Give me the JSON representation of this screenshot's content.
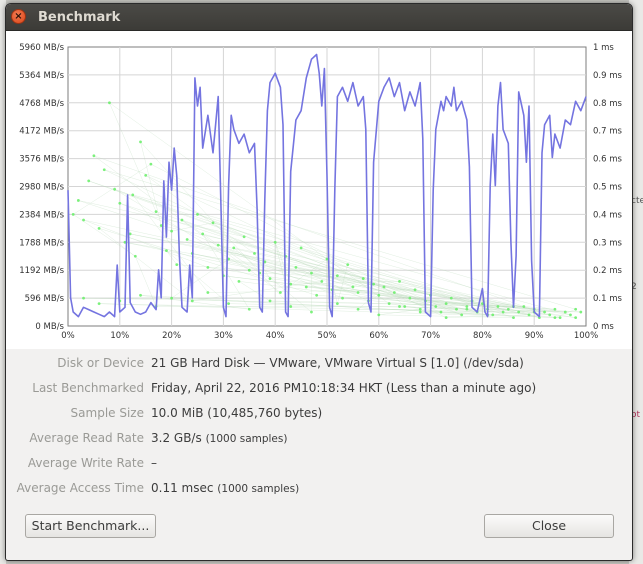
{
  "window": {
    "title": "Benchmark"
  },
  "background": {
    "frags": [
      "M",
      "M",
      "cte",
      "2",
      "ot"
    ]
  },
  "chart_data": [
    {
      "type": "line",
      "title": "",
      "xlabel": "",
      "ylabel": "",
      "x_ticks": [
        "0%",
        "10%",
        "20%",
        "30%",
        "40%",
        "50%",
        "60%",
        "70%",
        "80%",
        "90%",
        "100%"
      ],
      "y_left_ticks": [
        "0 MB/s",
        "596 MB/s",
        "1192 MB/s",
        "1788 MB/s",
        "2384 MB/s",
        "2980 MB/s",
        "3576 MB/s",
        "4172 MB/s",
        "4768 MB/s",
        "5364 MB/s",
        "5960 MB/s"
      ],
      "y_right_ticks": [
        "0 ms",
        "0.1 ms",
        "0.2 ms",
        "0.3 ms",
        "0.4 ms",
        "0.5 ms",
        "0.6 ms",
        "0.7 ms",
        "0.8 ms",
        "0.9 ms",
        "1 ms"
      ],
      "xlim": [
        0,
        100
      ],
      "ylim_left": [
        0,
        5960
      ],
      "ylim_right": [
        0,
        1
      ],
      "grid": true,
      "series_color": "#7474e0",
      "access_color": "#66ee66",
      "read_rate_points": [
        [
          0,
          2900
        ],
        [
          0.5,
          600
        ],
        [
          1,
          300
        ],
        [
          2,
          200
        ],
        [
          3,
          400
        ],
        [
          4,
          350
        ],
        [
          5,
          300
        ],
        [
          6,
          250
        ],
        [
          7,
          200
        ],
        [
          8,
          300
        ],
        [
          9,
          200
        ],
        [
          9.5,
          1300
        ],
        [
          10,
          300
        ],
        [
          11,
          400
        ],
        [
          11.5,
          2800
        ],
        [
          12,
          500
        ],
        [
          13,
          300
        ],
        [
          14,
          250
        ],
        [
          15,
          300
        ],
        [
          16,
          500
        ],
        [
          17,
          350
        ],
        [
          17.5,
          1200
        ],
        [
          18,
          600
        ],
        [
          18.5,
          3100
        ],
        [
          19,
          1900
        ],
        [
          19.5,
          3500
        ],
        [
          20,
          2900
        ],
        [
          20.5,
          3800
        ],
        [
          21,
          3200
        ],
        [
          21.5,
          1500
        ],
        [
          22,
          400
        ],
        [
          23,
          300
        ],
        [
          23.5,
          1300
        ],
        [
          24,
          600
        ],
        [
          24.5,
          5300
        ],
        [
          25,
          4700
        ],
        [
          25.5,
          5100
        ],
        [
          26,
          3800
        ],
        [
          27,
          4500
        ],
        [
          28,
          3700
        ],
        [
          29,
          4900
        ],
        [
          29.5,
          2700
        ],
        [
          30,
          400
        ],
        [
          30.5,
          200
        ],
        [
          31,
          3000
        ],
        [
          31.5,
          4500
        ],
        [
          32,
          4200
        ],
        [
          33,
          3900
        ],
        [
          34,
          4100
        ],
        [
          35,
          3700
        ],
        [
          36,
          3900
        ],
        [
          36.5,
          2500
        ],
        [
          37,
          400
        ],
        [
          37.5,
          300
        ],
        [
          38,
          2700
        ],
        [
          38.5,
          4600
        ],
        [
          39,
          5200
        ],
        [
          40,
          5400
        ],
        [
          41,
          5100
        ],
        [
          41.5,
          4300
        ],
        [
          42,
          300
        ],
        [
          42.5,
          200
        ],
        [
          43,
          3300
        ],
        [
          44,
          4400
        ],
        [
          45,
          4600
        ],
        [
          46,
          5300
        ],
        [
          47,
          5700
        ],
        [
          48,
          5800
        ],
        [
          48.5,
          5400
        ],
        [
          49,
          4700
        ],
        [
          49.5,
          5500
        ],
        [
          50,
          3200
        ],
        [
          50.5,
          400
        ],
        [
          51,
          200
        ],
        [
          51.5,
          2900
        ],
        [
          52,
          4900
        ],
        [
          53,
          5100
        ],
        [
          54,
          4800
        ],
        [
          55,
          5200
        ],
        [
          56,
          4700
        ],
        [
          57,
          4900
        ],
        [
          57.5,
          4200
        ],
        [
          58,
          500
        ],
        [
          58.5,
          300
        ],
        [
          59,
          3500
        ],
        [
          60,
          4800
        ],
        [
          61,
          5100
        ],
        [
          62,
          5300
        ],
        [
          63,
          4900
        ],
        [
          64,
          5200
        ],
        [
          65,
          4600
        ],
        [
          66,
          5000
        ],
        [
          67,
          4700
        ],
        [
          68,
          5200
        ],
        [
          68.5,
          4000
        ],
        [
          69,
          300
        ],
        [
          70,
          200
        ],
        [
          70.5,
          2900
        ],
        [
          71,
          4200
        ],
        [
          72,
          4800
        ],
        [
          72.5,
          4600
        ],
        [
          73,
          4900
        ],
        [
          74,
          4700
        ],
        [
          74.5,
          5100
        ],
        [
          75,
          4600
        ],
        [
          76,
          4800
        ],
        [
          77,
          4400
        ],
        [
          77.5,
          3400
        ],
        [
          78,
          400
        ],
        [
          79,
          300
        ],
        [
          80,
          800
        ],
        [
          80.5,
          300
        ],
        [
          81,
          200
        ],
        [
          81.5,
          3000
        ],
        [
          82,
          4100
        ],
        [
          82.5,
          3000
        ],
        [
          83,
          4700
        ],
        [
          83.5,
          5200
        ],
        [
          84,
          4200
        ],
        [
          85,
          3900
        ],
        [
          85.5,
          1800
        ],
        [
          86,
          400
        ],
        [
          86.5,
          1500
        ],
        [
          87,
          5000
        ],
        [
          88,
          4500
        ],
        [
          88.5,
          3500
        ],
        [
          89,
          4700
        ],
        [
          89.5,
          1400
        ],
        [
          90,
          300
        ],
        [
          91,
          200
        ],
        [
          91.5,
          3700
        ],
        [
          92,
          4300
        ],
        [
          93,
          4500
        ],
        [
          93.5,
          3600
        ],
        [
          94,
          4100
        ],
        [
          95,
          3800
        ],
        [
          96,
          4400
        ],
        [
          97,
          4300
        ],
        [
          98,
          4800
        ],
        [
          99,
          4600
        ],
        [
          100,
          4900
        ]
      ],
      "access_time_points": [
        [
          1,
          0.4
        ],
        [
          2,
          0.45
        ],
        [
          3,
          0.38
        ],
        [
          4,
          0.52
        ],
        [
          5,
          0.61
        ],
        [
          6,
          0.35
        ],
        [
          7,
          0.56
        ],
        [
          8,
          0.8
        ],
        [
          9,
          0.49
        ],
        [
          10,
          0.44
        ],
        [
          11,
          0.3
        ],
        [
          12,
          0.33
        ],
        [
          12.5,
          0.47
        ],
        [
          13,
          0.25
        ],
        [
          14,
          0.66
        ],
        [
          15,
          0.54
        ],
        [
          16,
          0.58
        ],
        [
          17,
          0.41
        ],
        [
          18,
          0.36
        ],
        [
          19,
          0.27
        ],
        [
          20,
          0.34
        ],
        [
          21,
          0.22
        ],
        [
          22,
          0.38
        ],
        [
          23,
          0.31
        ],
        [
          24,
          0.26
        ],
        [
          25,
          0.4
        ],
        [
          26,
          0.33
        ],
        [
          27,
          0.21
        ],
        [
          28,
          0.37
        ],
        [
          29,
          0.29
        ],
        [
          30,
          0.18
        ],
        [
          31,
          0.24
        ],
        [
          32,
          0.28
        ],
        [
          33,
          0.16
        ],
        [
          34,
          0.32
        ],
        [
          35,
          0.2
        ],
        [
          36,
          0.26
        ],
        [
          37,
          0.19
        ],
        [
          38,
          0.23
        ],
        [
          39,
          0.17
        ],
        [
          40,
          0.3
        ],
        [
          41,
          0.12
        ],
        [
          42,
          0.25
        ],
        [
          43,
          0.15
        ],
        [
          44,
          0.21
        ],
        [
          45,
          0.28
        ],
        [
          46,
          0.14
        ],
        [
          47,
          0.19
        ],
        [
          48,
          0.11
        ],
        [
          49,
          0.16
        ],
        [
          50,
          0.24
        ],
        [
          51,
          0.13
        ],
        [
          52,
          0.18
        ],
        [
          53,
          0.1
        ],
        [
          54,
          0.22
        ],
        [
          55,
          0.14
        ],
        [
          56,
          0.12
        ],
        [
          57,
          0.17
        ],
        [
          58,
          0.09
        ],
        [
          59,
          0.15
        ],
        [
          60,
          0.11
        ],
        [
          61,
          0.14
        ],
        [
          62,
          0.08
        ],
        [
          63,
          0.12
        ],
        [
          64,
          0.16
        ],
        [
          65,
          0.07
        ],
        [
          66,
          0.1
        ],
        [
          67,
          0.13
        ],
        [
          68,
          0.06
        ],
        [
          69,
          0.09
        ],
        [
          70,
          0.11
        ],
        [
          71,
          0.07
        ],
        [
          72,
          0.05
        ],
        [
          73,
          0.08
        ],
        [
          74,
          0.1
        ],
        [
          75,
          0.06
        ],
        [
          76,
          0.04
        ],
        [
          77,
          0.07
        ],
        [
          78,
          0.09
        ],
        [
          79,
          0.05
        ],
        [
          80,
          0.08
        ],
        [
          81,
          0.06
        ],
        [
          82,
          0.04
        ],
        [
          83,
          0.07
        ],
        [
          84,
          0.05
        ],
        [
          85,
          0.06
        ],
        [
          86,
          0.03
        ],
        [
          87,
          0.05
        ],
        [
          88,
          0.07
        ],
        [
          89,
          0.04
        ],
        [
          90,
          0.06
        ],
        [
          91,
          0.03
        ],
        [
          92,
          0.05
        ],
        [
          93,
          0.04
        ],
        [
          94,
          0.06
        ],
        [
          95,
          0.03
        ],
        [
          96,
          0.05
        ],
        [
          97,
          0.04
        ],
        [
          98,
          0.03
        ],
        [
          99,
          0.05
        ],
        [
          3,
          0.1
        ],
        [
          6,
          0.08
        ],
        [
          10,
          0.09
        ],
        [
          14,
          0.11
        ],
        [
          17,
          0.07
        ],
        [
          20,
          0.1
        ],
        [
          24,
          0.09
        ],
        [
          27,
          0.12
        ],
        [
          31,
          0.08
        ],
        [
          35,
          0.06
        ],
        [
          39,
          0.09
        ],
        [
          43,
          0.07
        ],
        [
          47,
          0.05
        ],
        [
          52,
          0.08
        ],
        [
          56,
          0.06
        ],
        [
          60,
          0.04
        ],
        [
          64,
          0.07
        ],
        [
          68,
          0.05
        ],
        [
          73,
          0.03
        ],
        [
          77,
          0.06
        ],
        [
          81,
          0.04
        ],
        [
          86,
          0.07
        ],
        [
          90,
          0.05
        ],
        [
          94,
          0.03
        ],
        [
          98,
          0.06
        ]
      ]
    }
  ],
  "info": {
    "rows": [
      {
        "label": "Disk or Device",
        "value": "21 GB Hard Disk — VMware, VMware Virtual S [1.0] (/dev/sda)",
        "extra": ""
      },
      {
        "label": "Last Benchmarked",
        "value": "Friday, April 22, 2016 PM10:18:34 HKT (Less than a minute ago)",
        "extra": ""
      },
      {
        "label": "Sample Size",
        "value": "10.0 MiB (10,485,760 bytes)",
        "extra": ""
      },
      {
        "label": "Average Read Rate",
        "value": "3.2 GB/s",
        "extra": "(1000 samples)"
      },
      {
        "label": "Average Write Rate",
        "value": "–",
        "extra": ""
      },
      {
        "label": "Average Access Time",
        "value": "0.11 msec",
        "extra": "(1000 samples)"
      }
    ]
  },
  "buttons": {
    "start": "Start Benchmark...",
    "close": "Close"
  }
}
